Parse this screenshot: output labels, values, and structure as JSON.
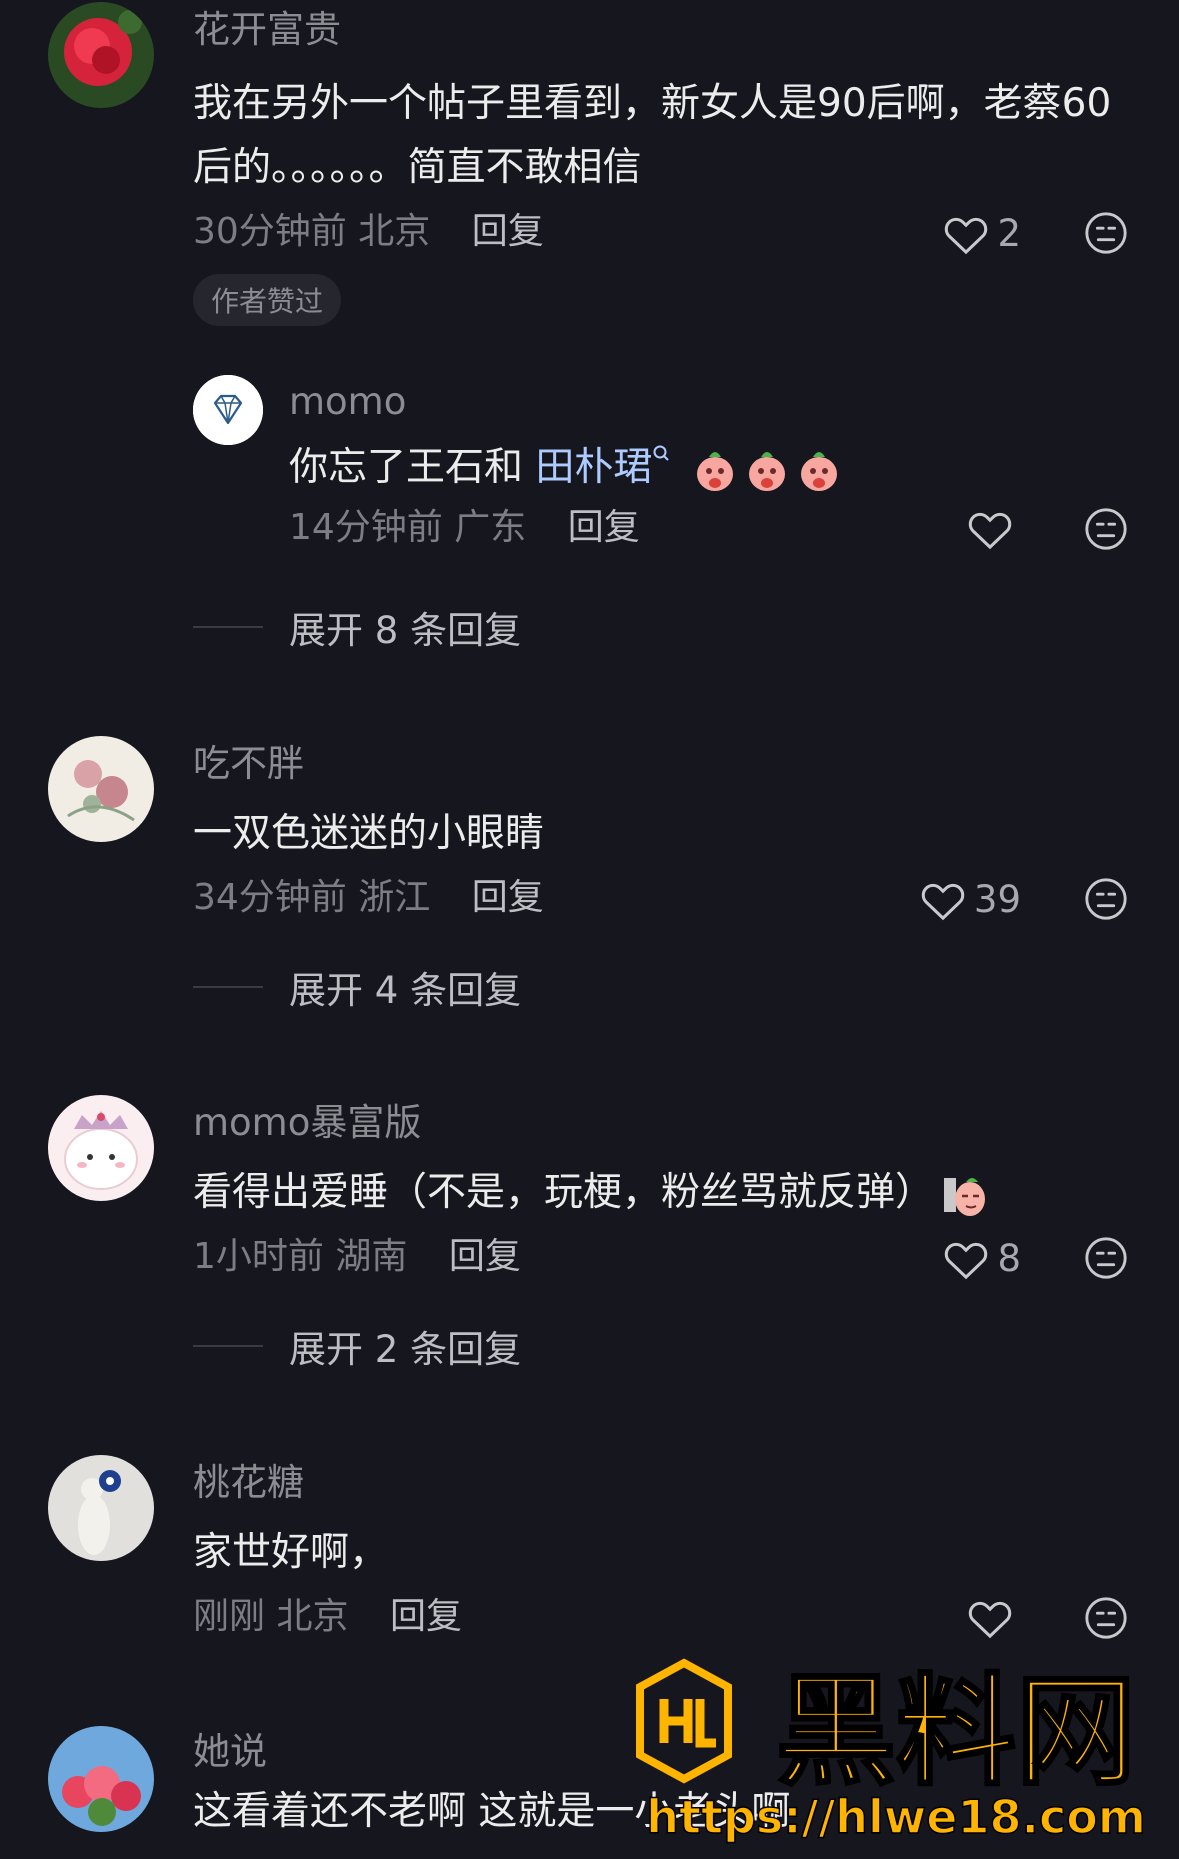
{
  "comments": [
    {
      "name": "花开富贵",
      "text": "我在另外一个帖子里看到，新女人是90后啊，老蔡60后的。。。。。。简直不敢相信",
      "time": "30分钟前",
      "location": "北京",
      "reply_label": "回复",
      "likes": "2",
      "badge": "作者赞过",
      "reply": {
        "name": "momo",
        "text_prefix": "你忘了王石和 ",
        "mention": "田朴珺",
        "time": "14分钟前",
        "location": "广东",
        "reply_label": "回复",
        "likes": ""
      },
      "expand": "展开 8 条回复"
    },
    {
      "name": "吃不胖",
      "text": "一双色迷迷的小眼睛",
      "time": "34分钟前",
      "location": "浙江",
      "reply_label": "回复",
      "likes": "39",
      "expand": "展开 4 条回复"
    },
    {
      "name": "momo暴富版",
      "text": "看得出爱睡（不是，玩梗，粉丝骂就反弹）",
      "time": "1小时前",
      "location": "湖南",
      "reply_label": "回复",
      "likes": "8",
      "expand": "展开 2 条回复"
    },
    {
      "name": "桃花糖",
      "text": "家世好啊，",
      "time": "刚刚",
      "location": "北京",
      "reply_label": "回复",
      "likes": ""
    },
    {
      "name": "她说",
      "text": "这看着还不老啊  这就是一小老头啊"
    }
  ],
  "watermark": {
    "title": "黑料网",
    "url": "https://hlwe18.com"
  },
  "colors": {
    "background": "#16161e",
    "watermark": "#ffb400"
  }
}
